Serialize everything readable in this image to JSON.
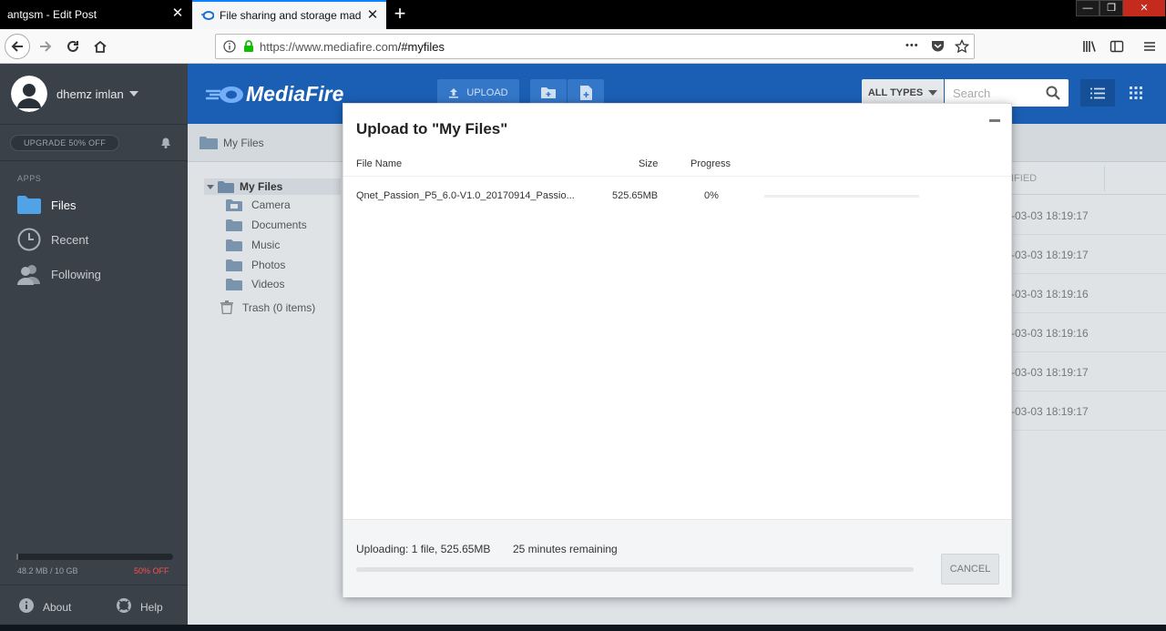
{
  "browser": {
    "tabs": [
      {
        "title": "antgsm - Edit Post",
        "active": false
      },
      {
        "title": "File sharing and storage made simple",
        "active": true
      }
    ],
    "url_host": "https://www.mediafire.com",
    "url_path": "/#myfiles",
    "menu_dots": "•••"
  },
  "user": {
    "name": "dhemz imlan"
  },
  "sidebar": {
    "upgrade_label": "UPGRADE 50% OFF",
    "apps_label": "APPS",
    "items": [
      {
        "label": "Files",
        "icon": "folder-icon",
        "active": true
      },
      {
        "label": "Recent",
        "icon": "clock-icon",
        "active": false
      },
      {
        "label": "Following",
        "icon": "people-icon",
        "active": false
      }
    ],
    "storage_text": "48.2 MB / 10 GB",
    "storage_offer": "50% OFF",
    "storage_used_fraction": 0.005,
    "footer": [
      {
        "label": "About",
        "icon": "info-icon"
      },
      {
        "label": "Help",
        "icon": "lifebuoy-icon"
      }
    ]
  },
  "topbar": {
    "logo": "MediaFire",
    "upload_label": "UPLOAD",
    "types_label": "ALL TYPES",
    "search_placeholder": "Search"
  },
  "breadcrumb": {
    "label": "My Files"
  },
  "tree": {
    "root": "My Files",
    "folders": [
      "Camera",
      "Documents",
      "Music",
      "Photos",
      "Videos"
    ],
    "trash": "Trash (0 items)"
  },
  "filelist": {
    "column": "IFIED",
    "rows": [
      "-03-03 18:19:17",
      "-03-03 18:19:17",
      "-03-03 18:19:16",
      "-03-03 18:19:16",
      "-03-03 18:19:17",
      "-03-03 18:19:17"
    ]
  },
  "modal": {
    "title": "Upload to \"My Files\"",
    "columns": {
      "name": "File Name",
      "size": "Size",
      "progress": "Progress"
    },
    "file": {
      "name": "Qnet_Passion_P5_6.0-V1.0_20170914_Passio...",
      "size": "525.65MB",
      "progress": "0%"
    },
    "footer": {
      "status": "Uploading: 1 file, 525.65MB",
      "remaining": "25 minutes remaining",
      "overall_progress_fraction": 0.0
    },
    "cancel_label": "CANCEL"
  },
  "colors": {
    "brand_blue": "#1a5fb4",
    "sidebar_bg": "#3a4149",
    "files_icon": "#4fa3e6",
    "danger": "#ff4d4d"
  }
}
